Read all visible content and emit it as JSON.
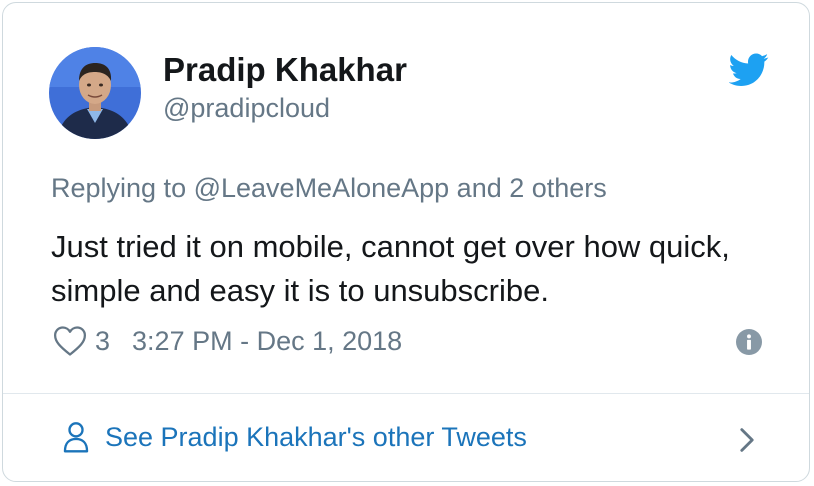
{
  "author": {
    "name": "Pradip Khakhar",
    "handle": "@pradipcloud"
  },
  "reply": {
    "prefix": "Replying to ",
    "users": "@LeaveMeAloneApp and 2 others"
  },
  "tweet": {
    "text": "Just tried it on mobile, cannot get over how quick, simple and easy it is to unsubscribe."
  },
  "meta": {
    "like_count": "3",
    "timestamp": "3:27 PM - Dec 1, 2018"
  },
  "footer": {
    "link_text": "See Pradip Khakhar's other Tweets"
  },
  "icons": {
    "brand": "twitter-bird-icon",
    "like": "heart-icon",
    "info": "info-icon",
    "profile": "person-icon",
    "more": "chevron-right-icon"
  },
  "colors": {
    "brand": "#1da1f2",
    "link": "#1b74ba",
    "secondary_text": "#657786",
    "primary_text": "#14171a",
    "border": "#cfd9de"
  }
}
